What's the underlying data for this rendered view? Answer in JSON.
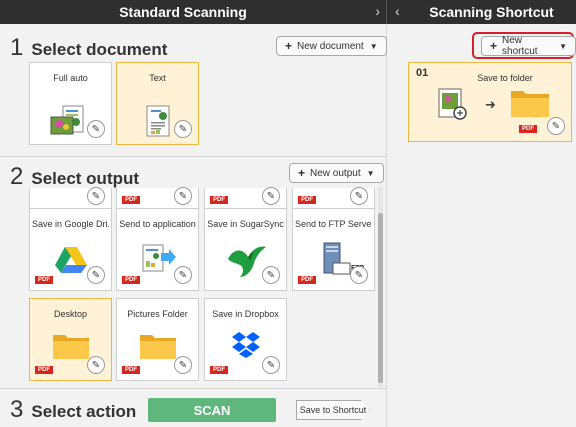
{
  "header": {
    "left_title": "Standard Scanning",
    "left_arrow": "›",
    "right_arrow": "‹",
    "right_title": "Scanning Shortcut"
  },
  "step1": {
    "num": "1",
    "label": "Select document",
    "new_button": "New document",
    "cards": [
      {
        "label": "Full auto",
        "selected": false,
        "icon": "photo-document-icon"
      },
      {
        "label": "Text",
        "selected": true,
        "icon": "text-document-icon"
      }
    ]
  },
  "step2": {
    "num": "2",
    "label": "Select output",
    "new_button": "New output",
    "partial_row_badges": [
      "PDF",
      "PDF",
      "PDF"
    ],
    "cards_row1": [
      {
        "label": "Save in Google Dri...",
        "badge": "PDF",
        "icon": "google-drive-icon"
      },
      {
        "label": "Send to application",
        "badge": "PDF",
        "icon": "send-to-application-icon"
      },
      {
        "label": "Save in SugarSync",
        "badge": "",
        "icon": "sugarsync-icon"
      },
      {
        "label": "Send to FTP Server",
        "badge": "PDF",
        "icon": "ftp-server-icon"
      }
    ],
    "cards_row2": [
      {
        "label": "Desktop",
        "badge": "PDF",
        "selected": true,
        "icon": "folder-icon"
      },
      {
        "label": "Pictures Folder",
        "badge": "PDF",
        "icon": "folder-icon"
      },
      {
        "label": "Save in Dropbox",
        "badge": "PDF",
        "icon": "dropbox-icon"
      }
    ],
    "ftp_tag": "FTP"
  },
  "step3": {
    "num": "3",
    "label": "Select action",
    "scan_button": "SCAN",
    "save_shortcut_button": "Save to Shortcut"
  },
  "shortcut_panel": {
    "new_button": "New shortcut",
    "card": {
      "num": "01",
      "name": "Save to folder",
      "badge": "PDF"
    }
  },
  "colors": {
    "selected_bg": "#fff2d6",
    "selected_border": "#f0b73f",
    "scan_green": "#5fb77e",
    "pdf_red": "#d7261e",
    "highlight_red": "#d4202a"
  }
}
